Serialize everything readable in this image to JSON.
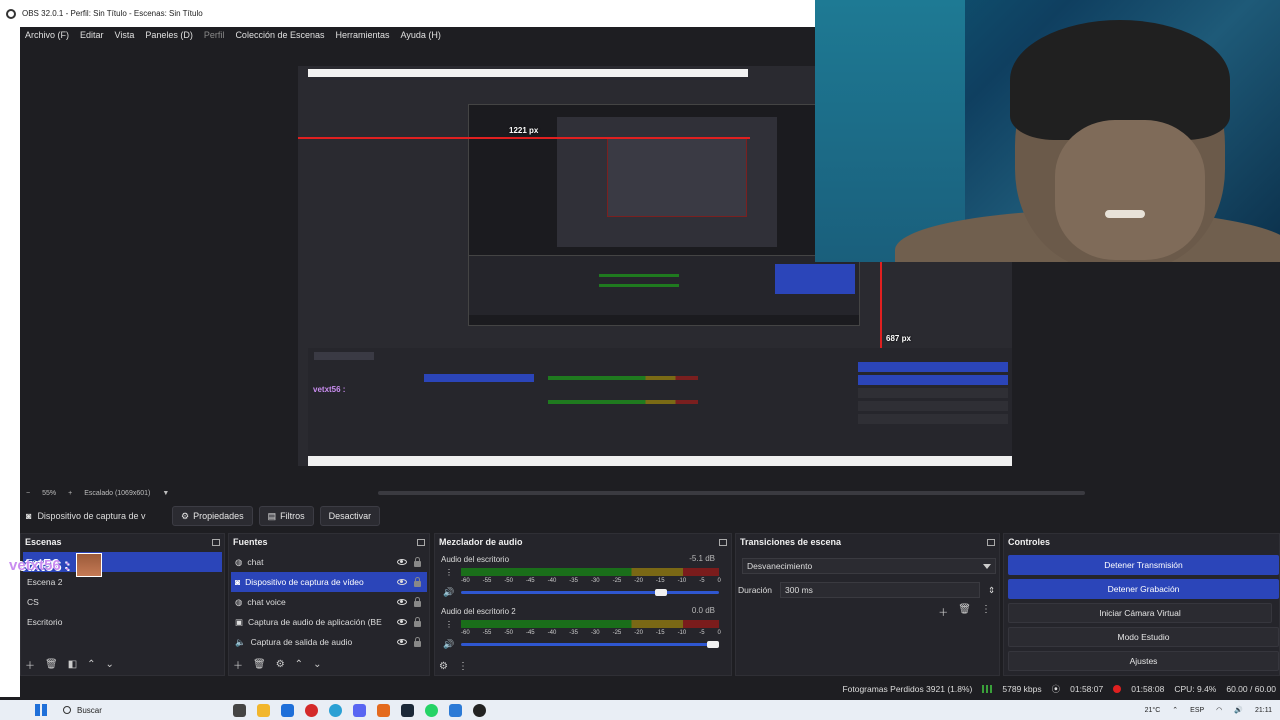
{
  "window": {
    "title": "OBS 32.0.1 - Perfil: Sin Título - Escenas: Sin Título"
  },
  "menu": [
    "Archivo (F)",
    "Editar",
    "Vista",
    "Paneles (D)",
    "Perfil",
    "Colección de Escenas",
    "Herramientas",
    "Ayuda (H)"
  ],
  "preview": {
    "width_label": "1221 px",
    "height_label": "687 px",
    "nested_user": "vetxt56 :"
  },
  "zoom": {
    "minus": "−",
    "level": "55%",
    "plus": "+",
    "scaling": "Escalado (1069x601)"
  },
  "source_toolbar": {
    "source_name": "Dispositivo de captura de v",
    "properties": "Propiedades",
    "filters": "Filtros",
    "deactivate": "Desactivar"
  },
  "scenes": {
    "title": "Escenas",
    "items": [
      "Escena",
      "Escena 2",
      "CS",
      "Escritorio"
    ]
  },
  "sources": {
    "title": "Fuentes",
    "items": [
      "chat",
      "Dispositivo de captura de vídeo",
      "chat voice",
      "Captura de audio de aplicación (BE",
      "Captura de salida de audio"
    ]
  },
  "mixer": {
    "title": "Mezclador de audio",
    "channels": [
      {
        "name": "Audio del escritorio",
        "db": "-5.1 dB",
        "volume": 0.8
      },
      {
        "name": "Audio del escritorio 2",
        "db": "0.0 dB",
        "volume": 1.0
      }
    ],
    "ticks": [
      "-60",
      "-55",
      "-50",
      "-45",
      "-40",
      "-35",
      "-30",
      "-25",
      "-20",
      "-15",
      "-10",
      "-5",
      "0"
    ]
  },
  "transitions": {
    "title": "Transiciones de escena",
    "selected": "Desvanecimiento",
    "duration_label": "Duración",
    "duration_value": "300 ms"
  },
  "controls": {
    "title": "Controles",
    "buttons": [
      "Detener Transmisión",
      "Detener Grabación",
      "Iniciar Cámara Virtual",
      "Modo Estudio",
      "Ajustes"
    ]
  },
  "status": {
    "dropped": "Fotogramas Perdidos 3921 (1.8%)",
    "bitrate": "5789 kbps",
    "stream_time": "01:58:07",
    "rec_time": "01:58:08",
    "cpu": "CPU: 9.4%",
    "fps": "60.00 / 60.00"
  },
  "overlay": {
    "username": "vetxt56 :"
  },
  "taskbar": {
    "search": "Buscar",
    "weather": "21°C",
    "lang": "ESP",
    "clock": "21:11"
  },
  "colors": {
    "accent": "#2b45b9",
    "guide_red": "#e02020",
    "username": "#c98df0"
  }
}
